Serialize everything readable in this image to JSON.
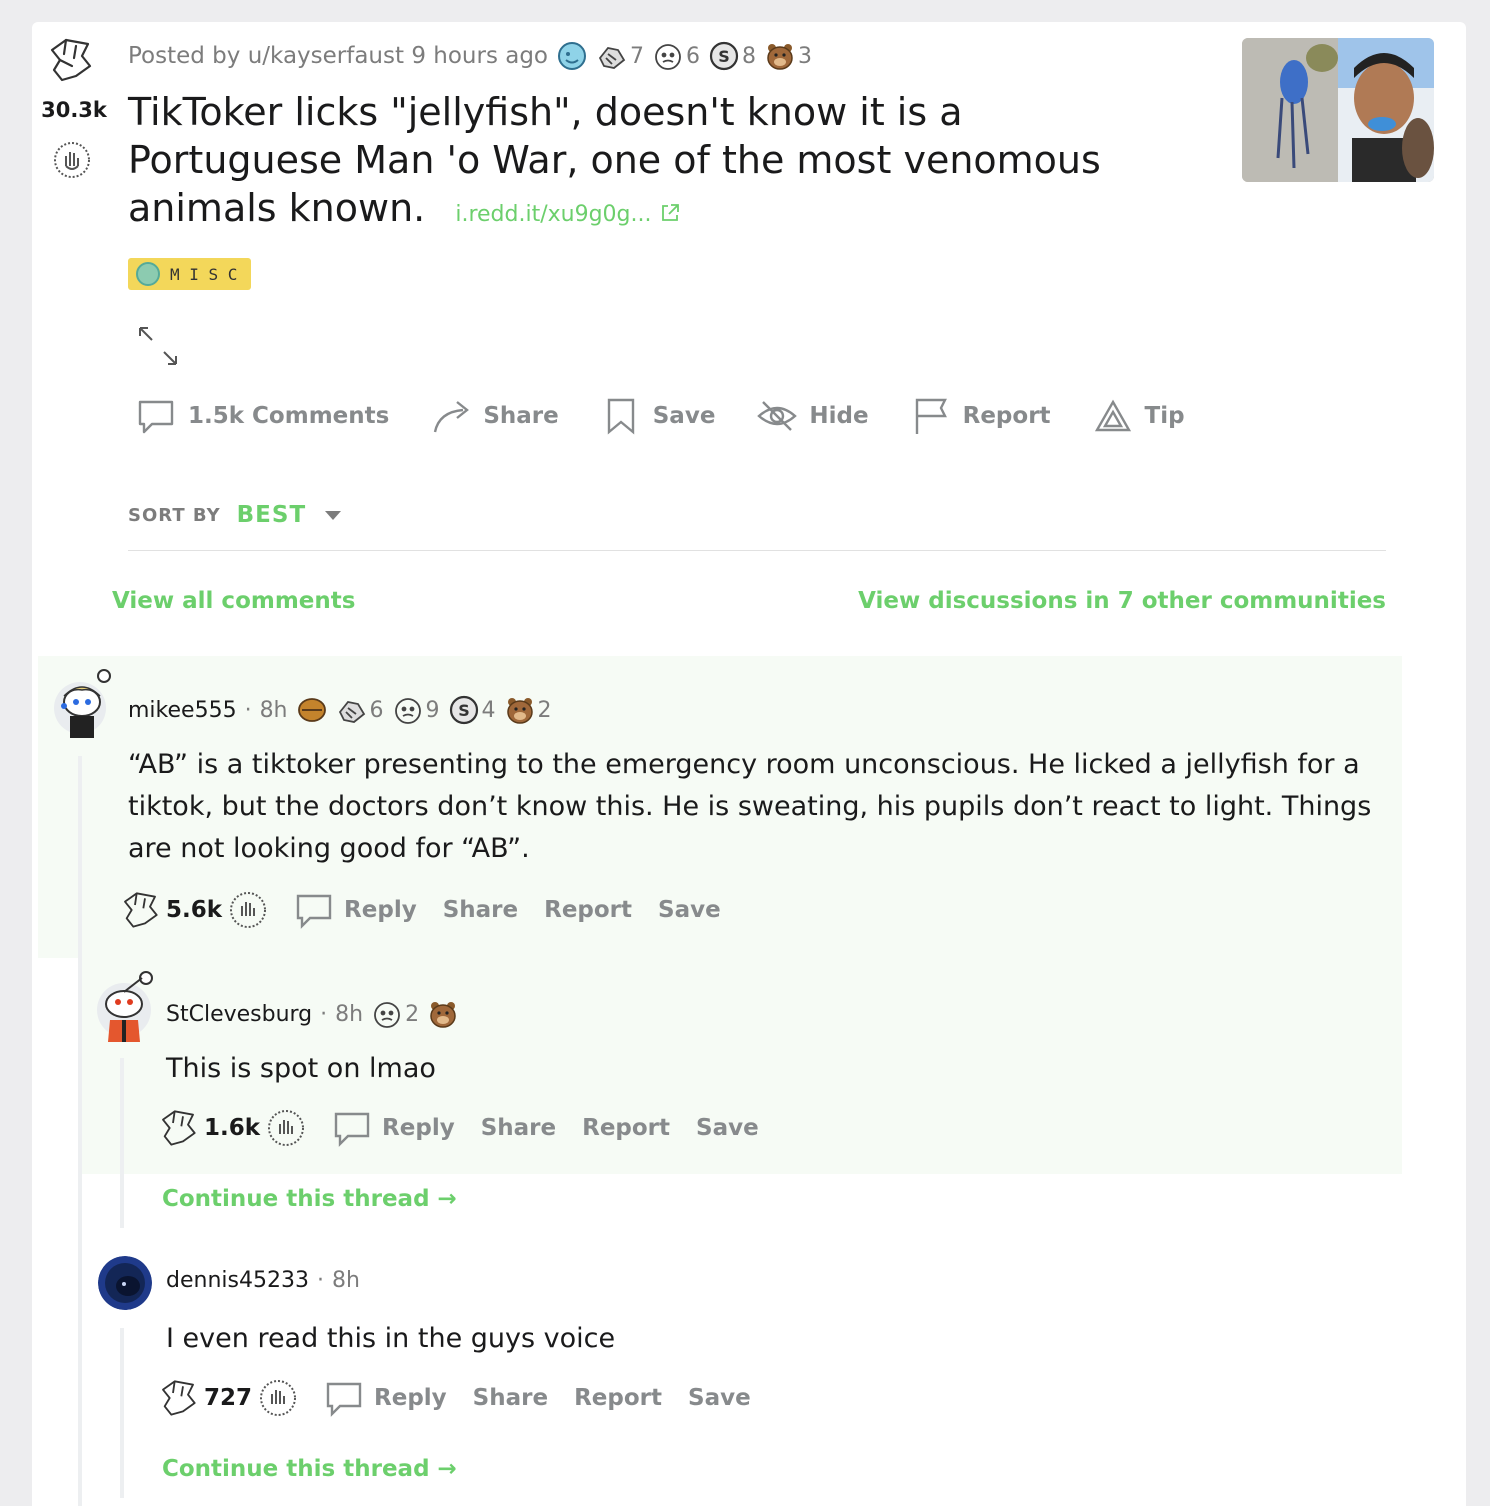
{
  "post": {
    "score": "30.3k",
    "posted_by": "Posted by u/kayserfaust 9 hours ago",
    "awards": [
      {
        "icon": "helpful-award-icon",
        "count": ""
      },
      {
        "icon": "handshake-award-icon",
        "count": "7"
      },
      {
        "icon": "face-award-icon",
        "count": "6"
      },
      {
        "icon": "silver-coin-icon",
        "count": "8"
      },
      {
        "icon": "bear-award-icon",
        "count": "3"
      }
    ],
    "title": "TikToker licks \"jellyfish\", doesn't know it is a Portuguese Man 'o War, one of the most venomous animals known.",
    "link": "i.redd.it/xu9g0g...",
    "flair": "M I S C"
  },
  "actions": {
    "comments": "1.5k Comments",
    "share": "Share",
    "save": "Save",
    "hide": "Hide",
    "report": "Report",
    "tip": "Tip"
  },
  "sort": {
    "label": "SORT BY",
    "value": "BEST"
  },
  "links": {
    "view_all": "View all comments",
    "view_discussions": "View discussions in 7 other communities"
  },
  "comments": [
    {
      "user": "mikee555",
      "sep": "·",
      "time": "8h",
      "award_counts": [
        "",
        "6",
        "9",
        "4",
        "2"
      ],
      "body": "“AB” is a tiktoker presenting to the emergency room unconscious. He licked a jellyfish for a tiktok, but the doctors don’t know this. He is sweating, his pupils don’t react to light. Things are not looking good for “AB”.",
      "score": "5.6k",
      "reply": "Reply",
      "share": "Share",
      "report": "Report",
      "save": "Save"
    },
    {
      "user": "StClevesburg",
      "sep": "·",
      "time": "8h",
      "award_counts": [
        "2",
        ""
      ],
      "body": "This is spot on lmao",
      "score": "1.6k",
      "reply": "Reply",
      "share": "Share",
      "report": "Report",
      "save": "Save",
      "continue": "Continue this thread →"
    },
    {
      "user": "dennis45233",
      "sep": "·",
      "time": "8h",
      "body": "I even read this in the guys voice",
      "score": "727",
      "reply": "Reply",
      "share": "Share",
      "report": "Report",
      "save": "Save",
      "continue": "Continue this thread →"
    }
  ],
  "colors": {
    "accent": "#6ccf6c",
    "flair_bg": "#f3d75a",
    "highlight_bg": "#f6fbf5"
  }
}
